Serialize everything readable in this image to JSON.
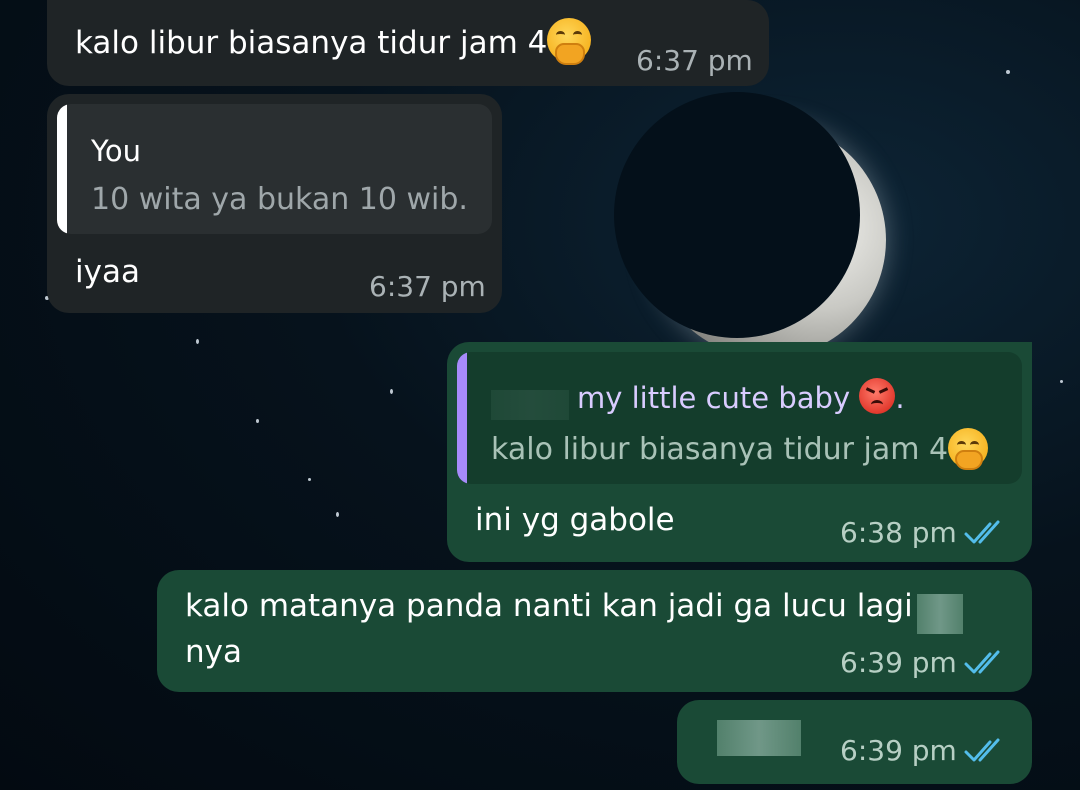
{
  "messages": [
    {
      "direction": "incoming",
      "text": "kalo libur biasanya tidur jam 4",
      "emoji": "hand-over-mouth-emoji",
      "time": "6:37 pm"
    },
    {
      "direction": "incoming",
      "quote": {
        "author": "You",
        "text": "10 wita ya bukan 10 wib."
      },
      "text": "iyaa",
      "time": "6:37 pm"
    },
    {
      "direction": "outgoing",
      "quote": {
        "author_visible": "my little cute baby",
        "author_suffix": ".",
        "author_emoji": "angry-face-emoji",
        "text": "kalo libur biasanya tidur jam 4",
        "text_emoji": "hand-over-mouth-emoji"
      },
      "text": "ini yg gabole",
      "time": "6:38 pm",
      "status": "read"
    },
    {
      "direction": "outgoing",
      "text_line1": "kalo matanya panda nanti kan jadi ga lucu lagi",
      "text_line2": "nya",
      "time": "6:39 pm",
      "status": "read"
    },
    {
      "direction": "outgoing",
      "time": "6:39 pm",
      "status": "read"
    }
  ],
  "colors": {
    "incoming_bubble": "#1f2426",
    "outgoing_bubble": "#1a4a36",
    "quote_bar_incoming": "#ffffff",
    "quote_bar_outgoing": "#a78bfa",
    "read_ticks": "#53bdeb"
  }
}
